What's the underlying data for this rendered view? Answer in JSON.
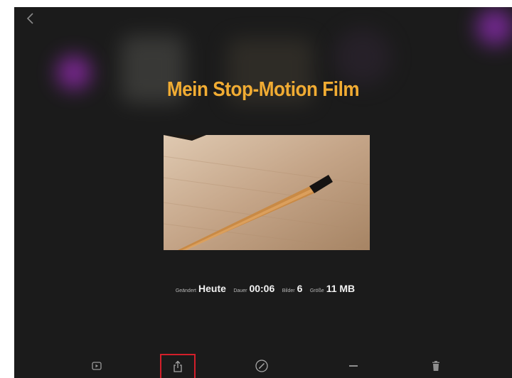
{
  "header": {
    "back_icon": "chevron-left-icon"
  },
  "project": {
    "title": "Mein Stop-Motion Film",
    "meta": [
      {
        "label": "Geändert",
        "value": "Heute"
      },
      {
        "label": "Dauer",
        "value": "00:06"
      },
      {
        "label": "Bilder",
        "value": "6"
      },
      {
        "label": "Größe",
        "value": "11 MB"
      }
    ]
  },
  "toolbar": {
    "items": [
      {
        "icon": "play-icon"
      },
      {
        "icon": "share-icon",
        "highlighted": true
      },
      {
        "icon": "edit-icon"
      },
      {
        "icon": "duplicate-icon"
      },
      {
        "icon": "trash-icon"
      }
    ]
  },
  "colors": {
    "title": "#f1ac33",
    "background": "#1b1b1b",
    "highlight": "#d31f2a"
  }
}
